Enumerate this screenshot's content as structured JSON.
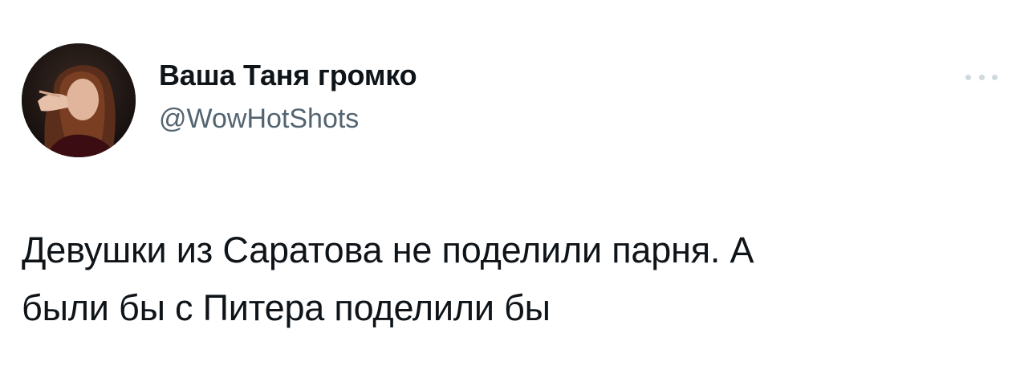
{
  "tweet": {
    "author": {
      "display_name": "Ваша Таня громко",
      "handle": "@WowHotShots",
      "avatar_icon": "profile-photo"
    },
    "more_icon": "more-horizontal-icon",
    "text": "Девушки из Саратова не поделили парня. А\nбыли бы с Питера поделили бы"
  },
  "colors": {
    "text_primary": "#0f1419",
    "text_secondary": "#536471",
    "more_dots": "#cfd9de",
    "background": "#ffffff"
  }
}
